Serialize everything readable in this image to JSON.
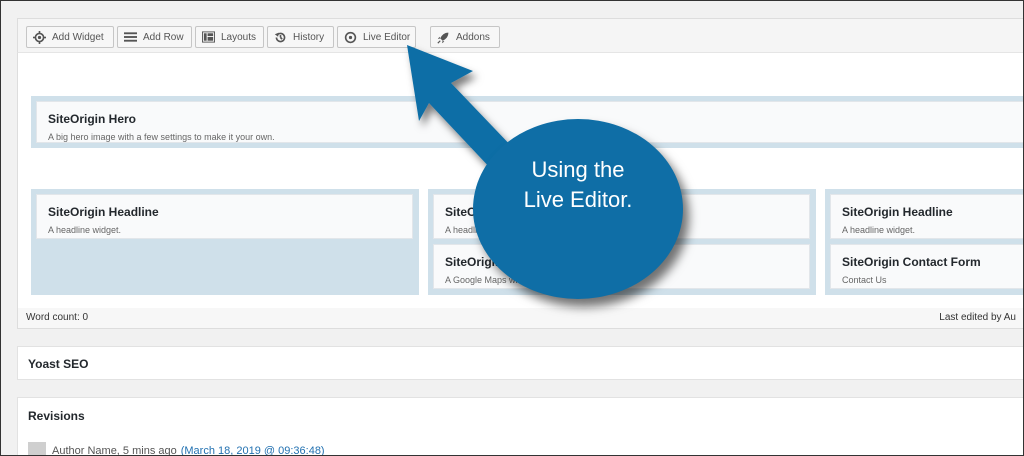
{
  "toolbar": {
    "buttons": [
      {
        "label": "Add Widget",
        "icon": "gear-icon"
      },
      {
        "label": "Add Row",
        "icon": "bars-icon"
      },
      {
        "label": "Layouts",
        "icon": "layout-icon"
      },
      {
        "label": "History",
        "icon": "history-icon"
      },
      {
        "label": "Live Editor",
        "icon": "eye-icon"
      },
      {
        "label": "Addons",
        "icon": "rocket-icon"
      }
    ]
  },
  "builder": {
    "hero": {
      "title": "SiteOrigin Hero",
      "desc": "A big hero image with a few settings to make it your own."
    },
    "col1": [
      {
        "title": "SiteOrigin Headline",
        "desc": "A headline widget."
      }
    ],
    "col2": [
      {
        "title": "SiteOrigin Headline",
        "desc": "A headline widget."
      },
      {
        "title": "SiteOrigin Google Maps",
        "desc": "A Google Maps widget."
      }
    ],
    "col3": [
      {
        "title": "SiteOrigin Headline",
        "desc": "A headline widget."
      },
      {
        "title": "SiteOrigin Contact Form",
        "desc": "Contact Us"
      }
    ]
  },
  "status": {
    "word_count": "Word count: 0",
    "last_edited": "Last edited by Au"
  },
  "yoast": {
    "title": "Yoast SEO"
  },
  "revisions": {
    "title": "Revisions",
    "author_line": "Author Name, 5 mins ago",
    "link": "(March 18, 2019 @ 09:36:48)"
  },
  "callout": {
    "line1": "Using the",
    "line2": "Live Editor."
  },
  "colors": {
    "callout": "#0f6ea6",
    "row_bg": "#cfe0ea",
    "link": "#2271b1"
  }
}
